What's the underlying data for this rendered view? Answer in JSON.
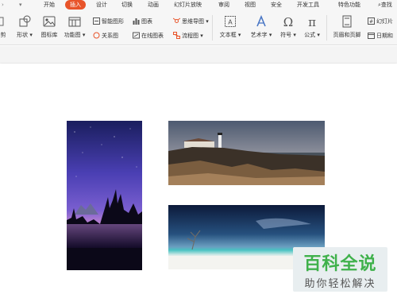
{
  "menu": {
    "items": [
      "开始",
      "插入",
      "设计",
      "切换",
      "动画",
      "幻灯片放映",
      "审阅",
      "视图",
      "安全",
      "开发工具",
      "特色功能"
    ],
    "active": "插入",
    "search": "查找"
  },
  "ribbon": {
    "cut_label": "剪",
    "shape_label": "形状",
    "icon_lib_label": "图标库",
    "func_chart_label": "功能图",
    "smart_shape_label": "智能图形",
    "chart_label": "图表",
    "relation_label": "关系图",
    "online_chart_label": "在线图表",
    "mindmap_label": "思维导图",
    "flowchart_label": "流程图",
    "textbox_label": "文本框",
    "wordart_label": "艺术字",
    "symbol_label": "符号",
    "formula_label": "公式",
    "header_footer_label": "页眉和页脚",
    "slide_num_label": "幻灯片",
    "datetime_label": "日期和"
  },
  "watermark": {
    "title": "百科全说",
    "subtitle": "助你轻松解决"
  }
}
